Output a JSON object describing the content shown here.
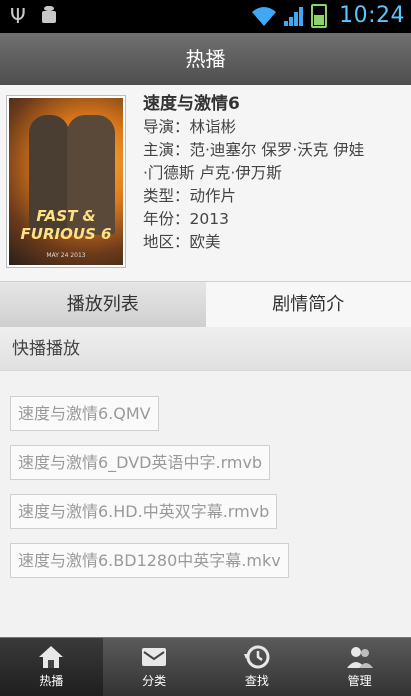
{
  "status_bar": {
    "time": "10:24",
    "icons": [
      "usb-icon",
      "android-debug-icon",
      "wifi-icon",
      "signal-icon",
      "battery-icon"
    ]
  },
  "title_bar": {
    "title": "热播"
  },
  "movie": {
    "title": "速度与激情6",
    "director": "导演：林诣彬",
    "cast_line1": "主演：范·迪塞尔 保罗·沃克 伊娃",
    "cast_line2": "·门德斯 卢克·伊万斯",
    "genre": "类型：动作片",
    "year": "年份：2013",
    "region": "地区：欧美",
    "poster": {
      "logo_text": "FAST & FURIOUS 6",
      "date_text": "MAY 24 2013"
    }
  },
  "tabs": [
    {
      "label": "播放列表",
      "active": true
    },
    {
      "label": "剧情简介",
      "active": false
    }
  ],
  "section": {
    "title": "快播播放"
  },
  "files": [
    "速度与激情6.QMV",
    "速度与激情6_DVD英语中字.rmvb",
    "速度与激情6.HD.中英双字幕.rmvb",
    "速度与激情6.BD1280中英字幕.mkv"
  ],
  "bottom_nav": [
    {
      "label": "热播",
      "icon": "home-icon",
      "active": true
    },
    {
      "label": "分类",
      "icon": "category-icon",
      "active": false
    },
    {
      "label": "查找",
      "icon": "search-history-icon",
      "active": false
    },
    {
      "label": "管理",
      "icon": "manage-users-icon",
      "active": false
    }
  ],
  "colors": {
    "clock": "#5ec4ff",
    "battery": "#8bd36a",
    "wifi": "#3fa9f5"
  }
}
